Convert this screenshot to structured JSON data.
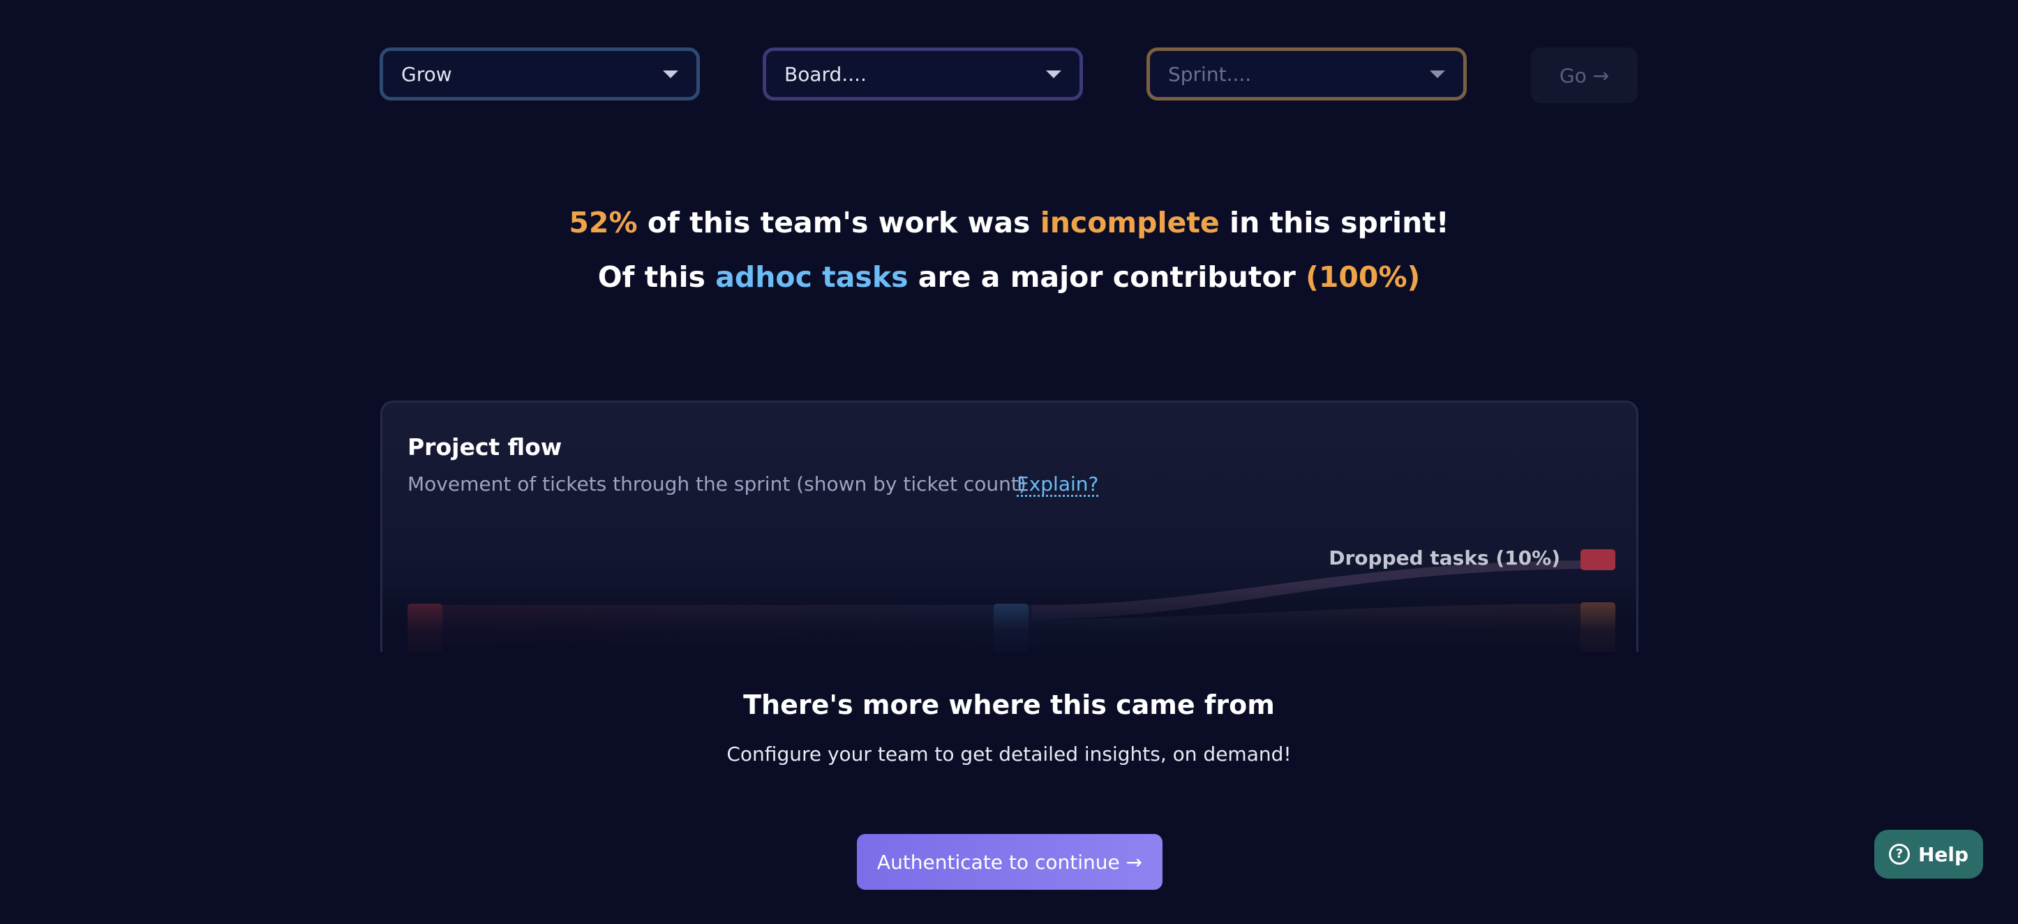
{
  "selectors": {
    "team": "Grow",
    "board": "Board....",
    "sprint_placeholder": "Sprint...."
  },
  "go_label": "Go →",
  "headline": {
    "line1_pct": "52%",
    "line1_mid": "of this team's work was",
    "line1_kw": "incomplete",
    "line1_end": "in this sprint!",
    "line2_start": "Of this",
    "line2_kw": "adhoc tasks",
    "line2_mid": "are a major contributor",
    "line2_pct": "(100%)"
  },
  "card": {
    "title": "Project flow",
    "subtitle": "Movement of tickets through the sprint (shown by ticket count)",
    "explain_link": "Explain?",
    "dropped_label": "Dropped tasks (10%)"
  },
  "cta": {
    "title": "There's more where this came from",
    "subtitle": "Configure your team to get detailed insights, on demand!",
    "button": "Authenticate to continue →"
  },
  "help": {
    "label": "Help",
    "icon_glyph": "?"
  },
  "colors": {
    "accent_orange": "#f0a44a",
    "accent_blue": "#6cbcf5",
    "button_purple": "#8f82f0",
    "help_teal": "#2b6b68"
  }
}
